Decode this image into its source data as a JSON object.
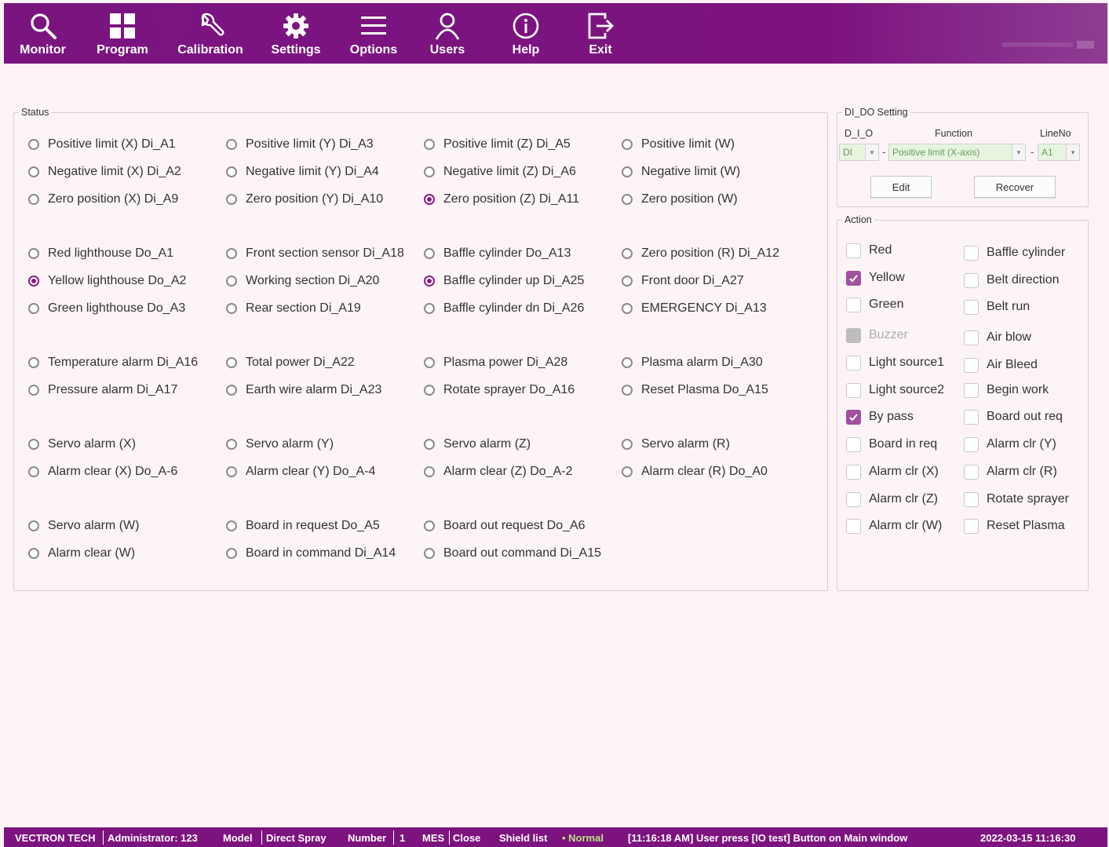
{
  "toolbar": {
    "buttons": [
      {
        "label": "Monitor",
        "icon": "search-icon"
      },
      {
        "label": "Program",
        "icon": "grid-icon"
      },
      {
        "label": "Calibration",
        "icon": "wrench-icon"
      },
      {
        "label": "Settings",
        "icon": "gear-icon"
      },
      {
        "label": "Options",
        "icon": "menu-icon"
      },
      {
        "label": "Users",
        "icon": "user-icon"
      },
      {
        "label": "Help",
        "icon": "info-icon"
      },
      {
        "label": "Exit",
        "icon": "exit-icon"
      }
    ],
    "accent": "#7d137f"
  },
  "status": {
    "title": "Status",
    "items": [
      {
        "label": "Positive limit (X) Di_A1",
        "checked": false
      },
      {
        "label": "Positive limit (Y) Di_A3",
        "checked": false
      },
      {
        "label": "Positive limit (Z) Di_A5",
        "checked": false
      },
      {
        "label": "Positive limit (W)",
        "checked": false
      },
      {
        "label": "Negative limit (X) Di_A2",
        "checked": false
      },
      {
        "label": "Negative limit (Y) Di_A4",
        "checked": false
      },
      {
        "label": "Negative limit (Z) Di_A6",
        "checked": false
      },
      {
        "label": "Negative limit (W)",
        "checked": false
      },
      {
        "label": "Zero position (X) Di_A9",
        "checked": false
      },
      {
        "label": "Zero position (Y) Di_A10",
        "checked": false
      },
      {
        "label": "Zero position (Z) Di_A11",
        "checked": true
      },
      {
        "label": "Zero position (W)",
        "checked": false
      },
      {
        "label": "Red lighthouse Do_A1",
        "checked": false
      },
      {
        "label": "Front section sensor Di_A18",
        "checked": false
      },
      {
        "label": "Baffle cylinder Do_A13",
        "checked": false
      },
      {
        "label": "Zero position (R) Di_A12",
        "checked": false
      },
      {
        "label": "Yellow lighthouse Do_A2",
        "checked": true
      },
      {
        "label": "Working section Di_A20",
        "checked": false
      },
      {
        "label": "Baffle cylinder up Di_A25",
        "checked": true
      },
      {
        "label": "Front door Di_A27",
        "checked": false
      },
      {
        "label": "Green lighthouse Do_A3",
        "checked": false
      },
      {
        "label": "Rear section Di_A19",
        "checked": false
      },
      {
        "label": "Baffle cylinder dn Di_A26",
        "checked": false
      },
      {
        "label": "EMERGENCY Di_A13",
        "checked": false
      },
      {
        "label": "Temperature alarm Di_A16",
        "checked": false
      },
      {
        "label": "Total power Di_A22",
        "checked": false
      },
      {
        "label": "Plasma power Di_A28",
        "checked": false
      },
      {
        "label": "Plasma alarm Di_A30",
        "checked": false
      },
      {
        "label": "Pressure alarm Di_A17",
        "checked": false
      },
      {
        "label": "Earth wire alarm Di_A23",
        "checked": false
      },
      {
        "label": "Rotate sprayer Do_A16",
        "checked": false
      },
      {
        "label": "Reset Plasma Do_A15",
        "checked": false
      },
      {
        "label": "Servo alarm (X)",
        "checked": false
      },
      {
        "label": "Servo alarm (Y)",
        "checked": false
      },
      {
        "label": "Servo alarm (Z)",
        "checked": false
      },
      {
        "label": "Servo alarm (R)",
        "checked": false
      },
      {
        "label": "Alarm clear  (X) Do_A-6",
        "checked": false
      },
      {
        "label": "Alarm clear  (Y) Do_A-4",
        "checked": false
      },
      {
        "label": "Alarm clear  (Z) Do_A-2",
        "checked": false
      },
      {
        "label": "Alarm clear  (R) Do_A0",
        "checked": false
      },
      {
        "label": "Servo alarm (W)",
        "checked": false
      },
      {
        "label": "Board in request Do_A5",
        "checked": false
      },
      {
        "label": "Board out request Do_A6",
        "checked": false
      },
      {
        "label": "Alarm clear  (W)",
        "checked": false
      },
      {
        "label": "Board in command Di_A14",
        "checked": false
      },
      {
        "label": "Board out command Di_A15",
        "checked": false
      }
    ]
  },
  "dido": {
    "title": "DI_DO Setting",
    "col_dio": "D_I_O",
    "col_function": "Function",
    "col_lineno": "LineNo",
    "dio_value": "DI",
    "function_value": "Positive limit (X-axis)",
    "lineno_value": "A1",
    "dash": "-",
    "edit_label": "Edit",
    "recover_label": "Recover"
  },
  "action": {
    "title": "Action",
    "items": [
      {
        "label": "Red",
        "checked": false,
        "disabled": false
      },
      {
        "label": "Baffle cylinder",
        "checked": false,
        "disabled": false
      },
      {
        "label": "Yellow",
        "checked": true,
        "disabled": false
      },
      {
        "label": "Belt direction",
        "checked": false,
        "disabled": false
      },
      {
        "label": "Green",
        "checked": false,
        "disabled": false
      },
      {
        "label": "Belt run",
        "checked": false,
        "disabled": false
      },
      {
        "label": "Buzzer",
        "checked": false,
        "disabled": true
      },
      {
        "label": "Air blow",
        "checked": false,
        "disabled": false
      },
      {
        "label": "Light source1",
        "checked": false,
        "disabled": false
      },
      {
        "label": "Air Bleed",
        "checked": false,
        "disabled": false
      },
      {
        "label": "Light source2",
        "checked": false,
        "disabled": false
      },
      {
        "label": "Begin work",
        "checked": false,
        "disabled": false
      },
      {
        "label": "By pass",
        "checked": true,
        "disabled": false
      },
      {
        "label": "Board out req",
        "checked": false,
        "disabled": false
      },
      {
        "label": "Board in req",
        "checked": false,
        "disabled": false
      },
      {
        "label": "Alarm clr  (Y)",
        "checked": false,
        "disabled": false
      },
      {
        "label": "Alarm clr  (X)",
        "checked": false,
        "disabled": false
      },
      {
        "label": "Alarm clr  (R)",
        "checked": false,
        "disabled": false
      },
      {
        "label": "Alarm clr  (Z)",
        "checked": false,
        "disabled": false
      },
      {
        "label": "Rotate sprayer",
        "checked": false,
        "disabled": false
      },
      {
        "label": "Alarm clr  (W)",
        "checked": false,
        "disabled": false
      },
      {
        "label": "Reset Plasma",
        "checked": false,
        "disabled": false
      }
    ]
  },
  "statusbar": {
    "company": "VECTRON TECH",
    "user": "Administrator: 123",
    "model_label": "Model",
    "model_value": "Direct Spray",
    "number_label": "Number",
    "number_value": "1",
    "mes_label": "MES",
    "mes_value": "Close",
    "shield_label": "Shield list",
    "shield_value": "• Normal",
    "message": "[11:16:18 AM] User press [IO test] Button on  Main window",
    "datetime": "2022-03-15  11:16:30"
  }
}
